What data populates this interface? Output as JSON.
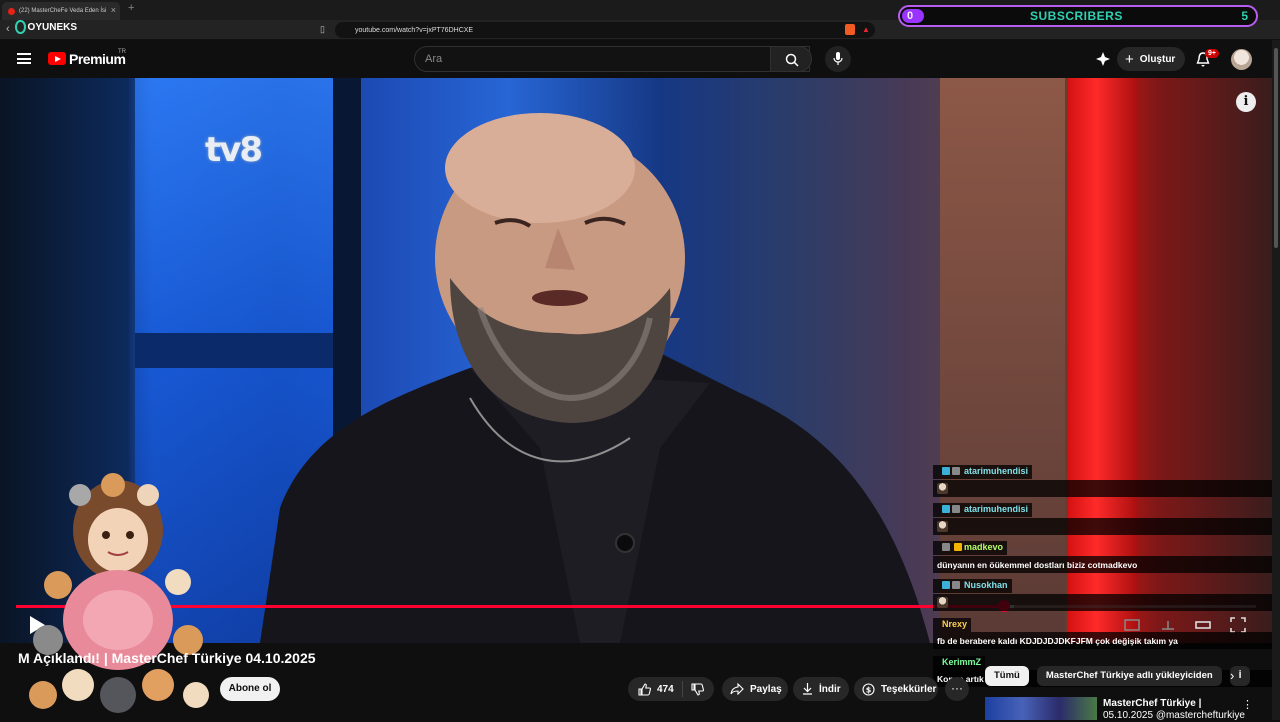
{
  "browser": {
    "tab_title": "(22) MasterCheFe Veda Eden İsi",
    "url": "youtube.com/watch?v=jxPT76DHCXE",
    "overlay_logo": "OYUNEKS"
  },
  "subscribers_widget": {
    "current": "0",
    "label": "SUBSCRIBERS",
    "goal": "5",
    "progress_fraction": 0.0
  },
  "header": {
    "brand": "Premium",
    "country": "TR",
    "search_placeholder": "Ara",
    "create_label": "Oluştur",
    "notifications_badge": "9+"
  },
  "player": {
    "channel_bug": "tv8",
    "progress_fraction": 0.797,
    "buffered_fraction": 0.805,
    "info_glyph": "i"
  },
  "chat": [
    {
      "user": "atarimuhendisi",
      "message": "",
      "badge": "blue",
      "emote": true
    },
    {
      "user": "atarimuhendisi",
      "message": "",
      "badge": "blue",
      "emote": true
    },
    {
      "user": "madkevo",
      "message": "dünyanın en öükemmel dostları biziz cotmadkevo",
      "badge": "gold",
      "emote": false
    },
    {
      "user": "Nusokhan",
      "message": "",
      "badge": "blue",
      "emote": true
    },
    {
      "user": "Nrexy",
      "message": "fb de berabere kaldı KDJDJDJDKFJFM çok değişik takım ya",
      "badge": "none",
      "emote": false
    },
    {
      "user": "KerimmZ",
      "message": "Konuş artık",
      "badge": "none",
      "emote": false
    }
  ],
  "video": {
    "title_visible": "M                Açıklandı! | MasterChef Türkiye 04.10.2025",
    "subscribe_label": "Abone ol",
    "like_count": "474",
    "share_label": "Paylaş",
    "download_label": "İndir",
    "thanks_label": "Teşekkürler",
    "more_label": "···"
  },
  "related": {
    "chips": [
      "Tümü",
      "MasterChef Türkiye adlı yükleyiciden",
      "İ"
    ],
    "first_title": "MasterChef Türkiye |",
    "first_subtitle": "05.10.2025 @masterchefturkiye"
  }
}
